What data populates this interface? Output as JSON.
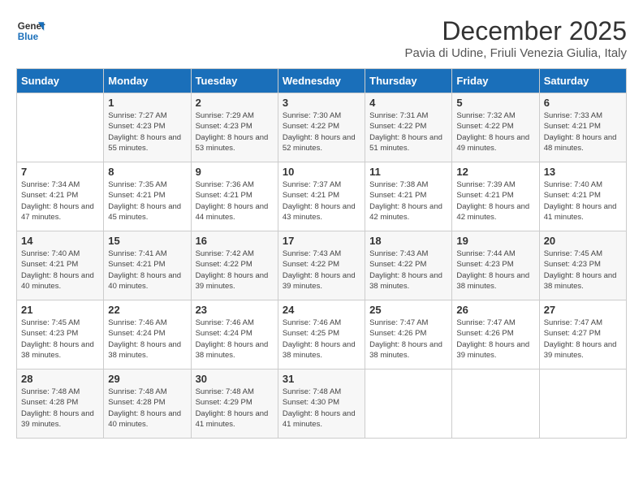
{
  "logo": {
    "line1": "General",
    "line2": "Blue"
  },
  "title": "December 2025",
  "subtitle": "Pavia di Udine, Friuli Venezia Giulia, Italy",
  "days": [
    "Sunday",
    "Monday",
    "Tuesday",
    "Wednesday",
    "Thursday",
    "Friday",
    "Saturday"
  ],
  "weeks": [
    [
      {
        "day": "",
        "sunrise": "",
        "sunset": "",
        "daylight": ""
      },
      {
        "day": "1",
        "sunrise": "Sunrise: 7:27 AM",
        "sunset": "Sunset: 4:23 PM",
        "daylight": "Daylight: 8 hours and 55 minutes."
      },
      {
        "day": "2",
        "sunrise": "Sunrise: 7:29 AM",
        "sunset": "Sunset: 4:23 PM",
        "daylight": "Daylight: 8 hours and 53 minutes."
      },
      {
        "day": "3",
        "sunrise": "Sunrise: 7:30 AM",
        "sunset": "Sunset: 4:22 PM",
        "daylight": "Daylight: 8 hours and 52 minutes."
      },
      {
        "day": "4",
        "sunrise": "Sunrise: 7:31 AM",
        "sunset": "Sunset: 4:22 PM",
        "daylight": "Daylight: 8 hours and 51 minutes."
      },
      {
        "day": "5",
        "sunrise": "Sunrise: 7:32 AM",
        "sunset": "Sunset: 4:22 PM",
        "daylight": "Daylight: 8 hours and 49 minutes."
      },
      {
        "day": "6",
        "sunrise": "Sunrise: 7:33 AM",
        "sunset": "Sunset: 4:21 PM",
        "daylight": "Daylight: 8 hours and 48 minutes."
      }
    ],
    [
      {
        "day": "7",
        "sunrise": "Sunrise: 7:34 AM",
        "sunset": "Sunset: 4:21 PM",
        "daylight": "Daylight: 8 hours and 47 minutes."
      },
      {
        "day": "8",
        "sunrise": "Sunrise: 7:35 AM",
        "sunset": "Sunset: 4:21 PM",
        "daylight": "Daylight: 8 hours and 45 minutes."
      },
      {
        "day": "9",
        "sunrise": "Sunrise: 7:36 AM",
        "sunset": "Sunset: 4:21 PM",
        "daylight": "Daylight: 8 hours and 44 minutes."
      },
      {
        "day": "10",
        "sunrise": "Sunrise: 7:37 AM",
        "sunset": "Sunset: 4:21 PM",
        "daylight": "Daylight: 8 hours and 43 minutes."
      },
      {
        "day": "11",
        "sunrise": "Sunrise: 7:38 AM",
        "sunset": "Sunset: 4:21 PM",
        "daylight": "Daylight: 8 hours and 42 minutes."
      },
      {
        "day": "12",
        "sunrise": "Sunrise: 7:39 AM",
        "sunset": "Sunset: 4:21 PM",
        "daylight": "Daylight: 8 hours and 42 minutes."
      },
      {
        "day": "13",
        "sunrise": "Sunrise: 7:40 AM",
        "sunset": "Sunset: 4:21 PM",
        "daylight": "Daylight: 8 hours and 41 minutes."
      }
    ],
    [
      {
        "day": "14",
        "sunrise": "Sunrise: 7:40 AM",
        "sunset": "Sunset: 4:21 PM",
        "daylight": "Daylight: 8 hours and 40 minutes."
      },
      {
        "day": "15",
        "sunrise": "Sunrise: 7:41 AM",
        "sunset": "Sunset: 4:21 PM",
        "daylight": "Daylight: 8 hours and 40 minutes."
      },
      {
        "day": "16",
        "sunrise": "Sunrise: 7:42 AM",
        "sunset": "Sunset: 4:22 PM",
        "daylight": "Daylight: 8 hours and 39 minutes."
      },
      {
        "day": "17",
        "sunrise": "Sunrise: 7:43 AM",
        "sunset": "Sunset: 4:22 PM",
        "daylight": "Daylight: 8 hours and 39 minutes."
      },
      {
        "day": "18",
        "sunrise": "Sunrise: 7:43 AM",
        "sunset": "Sunset: 4:22 PM",
        "daylight": "Daylight: 8 hours and 38 minutes."
      },
      {
        "day": "19",
        "sunrise": "Sunrise: 7:44 AM",
        "sunset": "Sunset: 4:23 PM",
        "daylight": "Daylight: 8 hours and 38 minutes."
      },
      {
        "day": "20",
        "sunrise": "Sunrise: 7:45 AM",
        "sunset": "Sunset: 4:23 PM",
        "daylight": "Daylight: 8 hours and 38 minutes."
      }
    ],
    [
      {
        "day": "21",
        "sunrise": "Sunrise: 7:45 AM",
        "sunset": "Sunset: 4:23 PM",
        "daylight": "Daylight: 8 hours and 38 minutes."
      },
      {
        "day": "22",
        "sunrise": "Sunrise: 7:46 AM",
        "sunset": "Sunset: 4:24 PM",
        "daylight": "Daylight: 8 hours and 38 minutes."
      },
      {
        "day": "23",
        "sunrise": "Sunrise: 7:46 AM",
        "sunset": "Sunset: 4:24 PM",
        "daylight": "Daylight: 8 hours and 38 minutes."
      },
      {
        "day": "24",
        "sunrise": "Sunrise: 7:46 AM",
        "sunset": "Sunset: 4:25 PM",
        "daylight": "Daylight: 8 hours and 38 minutes."
      },
      {
        "day": "25",
        "sunrise": "Sunrise: 7:47 AM",
        "sunset": "Sunset: 4:26 PM",
        "daylight": "Daylight: 8 hours and 38 minutes."
      },
      {
        "day": "26",
        "sunrise": "Sunrise: 7:47 AM",
        "sunset": "Sunset: 4:26 PM",
        "daylight": "Daylight: 8 hours and 39 minutes."
      },
      {
        "day": "27",
        "sunrise": "Sunrise: 7:47 AM",
        "sunset": "Sunset: 4:27 PM",
        "daylight": "Daylight: 8 hours and 39 minutes."
      }
    ],
    [
      {
        "day": "28",
        "sunrise": "Sunrise: 7:48 AM",
        "sunset": "Sunset: 4:28 PM",
        "daylight": "Daylight: 8 hours and 39 minutes."
      },
      {
        "day": "29",
        "sunrise": "Sunrise: 7:48 AM",
        "sunset": "Sunset: 4:28 PM",
        "daylight": "Daylight: 8 hours and 40 minutes."
      },
      {
        "day": "30",
        "sunrise": "Sunrise: 7:48 AM",
        "sunset": "Sunset: 4:29 PM",
        "daylight": "Daylight: 8 hours and 41 minutes."
      },
      {
        "day": "31",
        "sunrise": "Sunrise: 7:48 AM",
        "sunset": "Sunset: 4:30 PM",
        "daylight": "Daylight: 8 hours and 41 minutes."
      },
      {
        "day": "",
        "sunrise": "",
        "sunset": "",
        "daylight": ""
      },
      {
        "day": "",
        "sunrise": "",
        "sunset": "",
        "daylight": ""
      },
      {
        "day": "",
        "sunrise": "",
        "sunset": "",
        "daylight": ""
      }
    ]
  ]
}
